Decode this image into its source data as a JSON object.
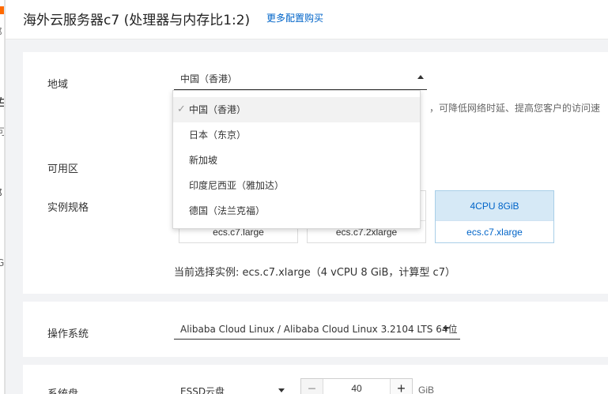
{
  "header": {
    "title": "海外云服务器c7 (处理器与内存比1:2)",
    "more_link": "更多配置购买"
  },
  "region": {
    "label": "地域",
    "selected": "中国（香港）",
    "hint_partial": "，可降低网络时延、提高您客户的访问速",
    "options": [
      {
        "label": "中国（香港）",
        "selected": true
      },
      {
        "label": "日本（东京）",
        "selected": false
      },
      {
        "label": "新加坡",
        "selected": false
      },
      {
        "label": "印度尼西亚（雅加达）",
        "selected": false
      },
      {
        "label": "德国（法兰克福）",
        "selected": false
      }
    ]
  },
  "zone": {
    "label": "可用区"
  },
  "instance": {
    "label": "实例规格",
    "specs": [
      {
        "cpu": "",
        "name": "ecs.c7.large",
        "selected": false
      },
      {
        "cpu": "",
        "name": "ecs.c7.2xlarge",
        "selected": false
      },
      {
        "cpu": "4CPU 8GiB",
        "name": "ecs.c7.xlarge",
        "selected": true
      }
    ],
    "current": "当前选择实例: ecs.c7.xlarge（4 vCPU 8 GiB，计算型 c7）"
  },
  "os": {
    "label": "操作系统",
    "selected": "Alibaba Cloud Linux / Alibaba Cloud Linux 3.2104 LTS 64位"
  },
  "disk": {
    "label": "系统盘",
    "type": "ESSD云盘",
    "size": "40",
    "unit": "GiB",
    "minus": "−",
    "plus": "+"
  },
  "peek": {
    "items": [
      "阝",
      "与",
      "可",
      "阝",
      "ŀ",
      "G"
    ]
  },
  "colors": {
    "link": "#0064c8",
    "selected_bg": "#d6e9f6",
    "peek_accent": "#ff6a00"
  },
  "icons": {
    "check": "✓"
  }
}
